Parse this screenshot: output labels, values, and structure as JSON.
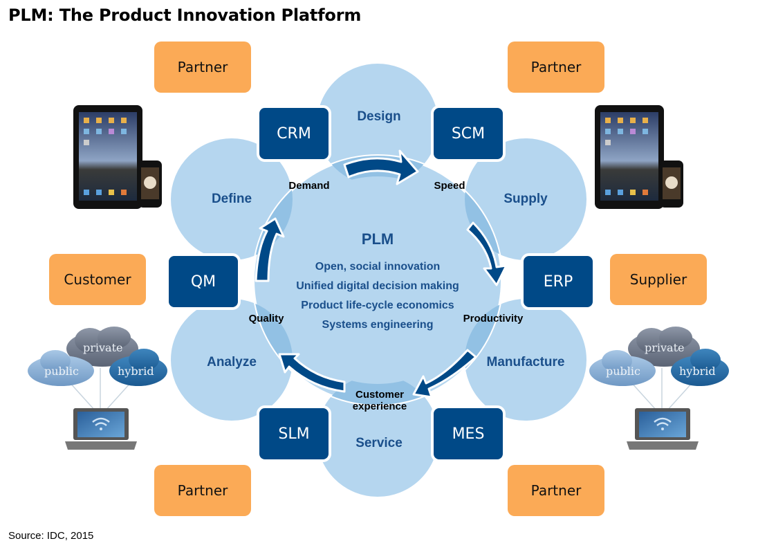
{
  "title": "PLM: The Product Innovation Platform",
  "source": "Source: IDC, 2015",
  "colors": {
    "stage_circle": "#b5d6ef",
    "overlap": "#92c1e4",
    "system_box": "#004987",
    "orange_box": "#fbaa56",
    "arrow": "#004987",
    "stage_text": "#1a4f8b"
  },
  "center": {
    "title": "PLM",
    "items": [
      "Open, social innovation",
      "Unified digital decision making",
      "Product life-cycle economics",
      "Systems engineering"
    ]
  },
  "stages": {
    "design": "Design",
    "supply": "Supply",
    "manufacture": "Manufacture",
    "service": "Service",
    "analyze": "Analyze",
    "define": "Define"
  },
  "systems": {
    "crm": "CRM",
    "scm": "SCM",
    "erp": "ERP",
    "mes": "MES",
    "slm": "SLM",
    "qm": "QM"
  },
  "drivers": {
    "demand": "Demand",
    "speed": "Speed",
    "productivity": "Productivity",
    "customer_experience": [
      "Customer",
      "experience"
    ],
    "quality": "Quality"
  },
  "stakeholders": {
    "partner_top_left": "Partner",
    "partner_top_right": "Partner",
    "customer": "Customer",
    "supplier": "Supplier",
    "partner_bottom_left": "Partner",
    "partner_bottom_right": "Partner"
  },
  "clouds": {
    "private": "private",
    "public": "public",
    "hybrid": "hybrid"
  },
  "icons": {
    "devices": "tablet-and-phone-icon",
    "cloud_laptop": "cloud-laptop-icon"
  }
}
